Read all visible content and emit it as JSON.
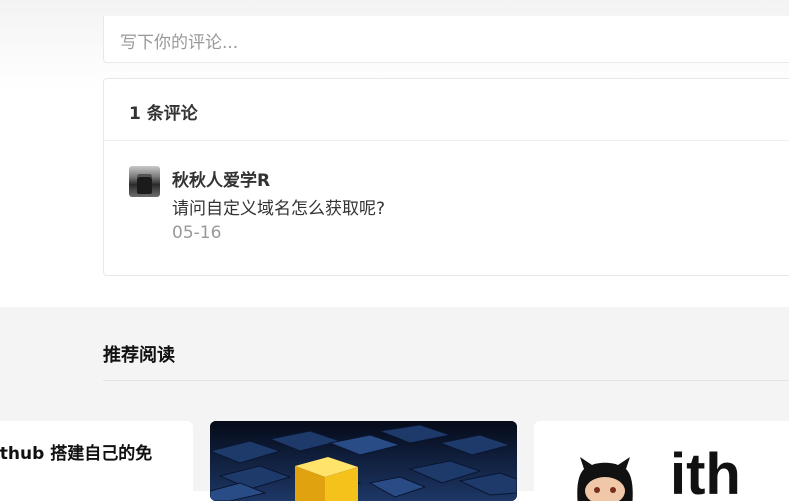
{
  "comment_form": {
    "placeholder": "写下你的评论..."
  },
  "comments": {
    "header": "1 条评论",
    "items": [
      {
        "author": "秋秋人爱学R",
        "text": "请问自定义域名怎么获取呢?",
        "date": "05-16"
      }
    ]
  },
  "recommended": {
    "title": "推荐阅读",
    "cards": [
      {
        "title": "Github 搭建自己的免"
      },
      {
        "image": "blue-cubes-image"
      },
      {
        "image": "github-logo-image",
        "logo_text": "ith"
      }
    ]
  },
  "colors": {
    "accent_cube": "#f5c21b",
    "dark_bg": "#0b1a33"
  }
}
